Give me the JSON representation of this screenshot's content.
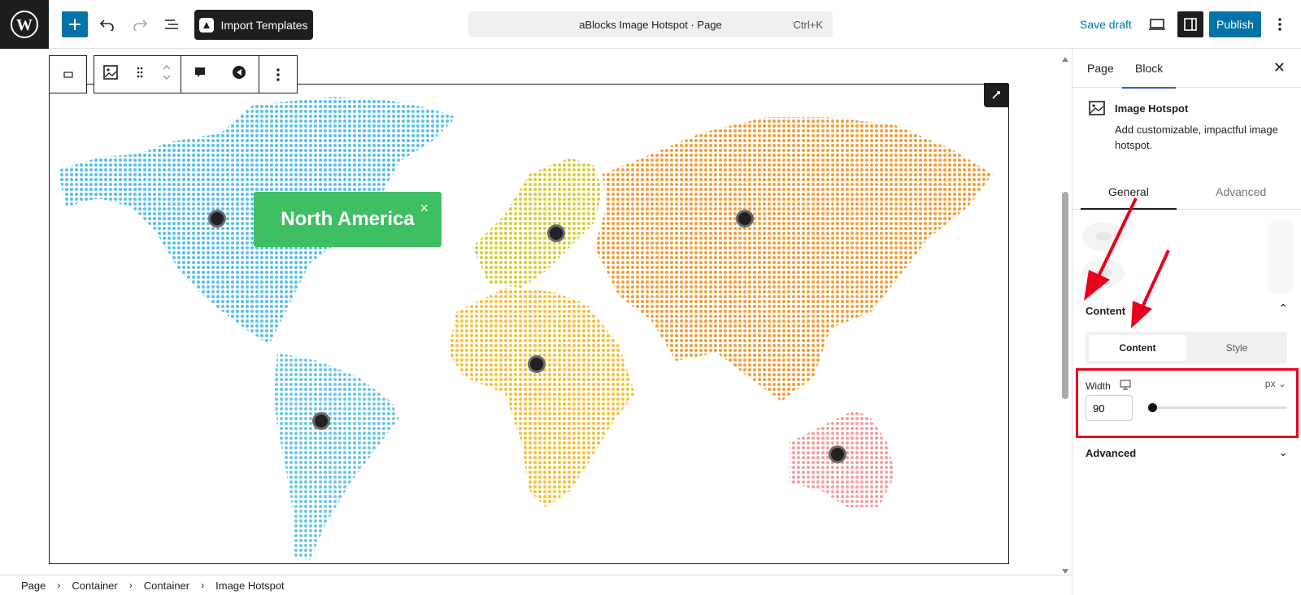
{
  "topbar": {
    "import_label": "Import Templates",
    "command_title": "aBlocks Image Hotspot · Page",
    "command_shortcut": "Ctrl+K",
    "save_draft": "Save draft",
    "publish": "Publish"
  },
  "canvas": {
    "tooltip_title": "North America",
    "close_glyph": "×"
  },
  "breadcrumb": [
    "Page",
    "Container",
    "Container",
    "Image Hotspot"
  ],
  "sidebar": {
    "tabs": [
      "Page",
      "Block"
    ],
    "active_tab": "Block",
    "block_name": "Image Hotspot",
    "block_desc": "Add customizable, impactful image hotspot.",
    "inner_tabs": [
      "General",
      "Advanced"
    ],
    "content_section": "Content",
    "segment": [
      "Content",
      "Style"
    ],
    "width_label": "Width",
    "width_unit": "px",
    "width_value": "90",
    "advanced_section": "Advanced"
  },
  "colors": {
    "accent": "#0073aa",
    "highlight": "#e8001c",
    "tooltip": "#3fbf63",
    "north_america": "#5bc0eb",
    "south_america": "#6ec6e6",
    "europe": "#d6cf3a",
    "africa": "#f4c23a",
    "asia": "#f0a03a",
    "australia": "#f2a0a0"
  }
}
